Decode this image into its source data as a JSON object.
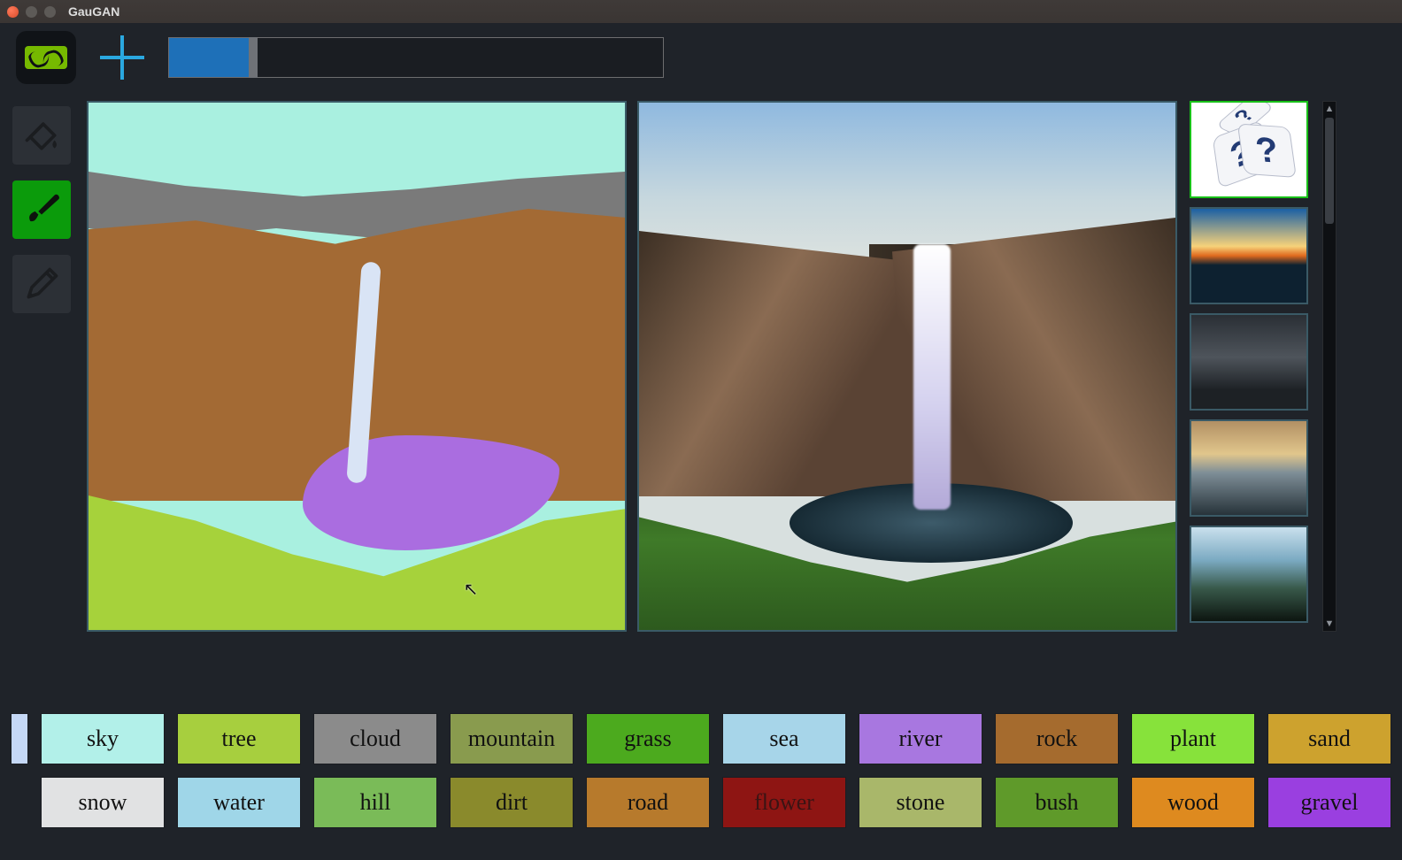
{
  "window": {
    "title": "GauGAN"
  },
  "toolbar": {
    "slider": {
      "value_pct": 17,
      "track_pct": 100
    },
    "buttons": {
      "logo": "nvidia-logo",
      "new": "plus-icon"
    }
  },
  "tools": [
    {
      "id": "fill",
      "icon": "paint-bucket-icon",
      "selected": false
    },
    {
      "id": "brush",
      "icon": "brush-icon",
      "selected": true
    },
    {
      "id": "pencil",
      "icon": "pencil-icon",
      "selected": false
    }
  ],
  "styles": {
    "selected_index": 0,
    "items": [
      {
        "id": "random",
        "label": "?"
      },
      {
        "id": "sunset"
      },
      {
        "id": "storm"
      },
      {
        "id": "dusk"
      },
      {
        "id": "waves"
      }
    ]
  },
  "current_swatch_color": "#c5d8f6",
  "palette": [
    {
      "label": "sky",
      "color": "#b2f0e9",
      "text": "dark"
    },
    {
      "label": "tree",
      "color": "#a7cf3e",
      "text": "dark"
    },
    {
      "label": "cloud",
      "color": "#8b8b8b",
      "text": "dark"
    },
    {
      "label": "mountain",
      "color": "#899b4e",
      "text": "dark"
    },
    {
      "label": "grass",
      "color": "#4caa1e",
      "text": "dark"
    },
    {
      "label": "sea",
      "color": "#a7d5e9",
      "text": "dark"
    },
    {
      "label": "river",
      "color": "#a877e0",
      "text": "dark"
    },
    {
      "label": "rock",
      "color": "#a56b2e",
      "text": "dark"
    },
    {
      "label": "plant",
      "color": "#87e23b",
      "text": "dark"
    },
    {
      "label": "sand",
      "color": "#cda22e",
      "text": "dark"
    },
    {
      "label": "snow",
      "color": "#e1e2e3",
      "text": "dark"
    },
    {
      "label": "water",
      "color": "#9fd6e8",
      "text": "dark"
    },
    {
      "label": "hill",
      "color": "#7abb58",
      "text": "dark"
    },
    {
      "label": "dirt",
      "color": "#8a8a2c",
      "text": "dark"
    },
    {
      "label": "road",
      "color": "#b77a2c",
      "text": "dark"
    },
    {
      "label": "flower",
      "color": "#8e1513",
      "text": "dim"
    },
    {
      "label": "stone",
      "color": "#a9b76a",
      "text": "dark"
    },
    {
      "label": "bush",
      "color": "#5f9a2a",
      "text": "dark"
    },
    {
      "label": "wood",
      "color": "#de8a1f",
      "text": "dark"
    },
    {
      "label": "gravel",
      "color": "#9a3fe0",
      "text": "dark"
    }
  ]
}
